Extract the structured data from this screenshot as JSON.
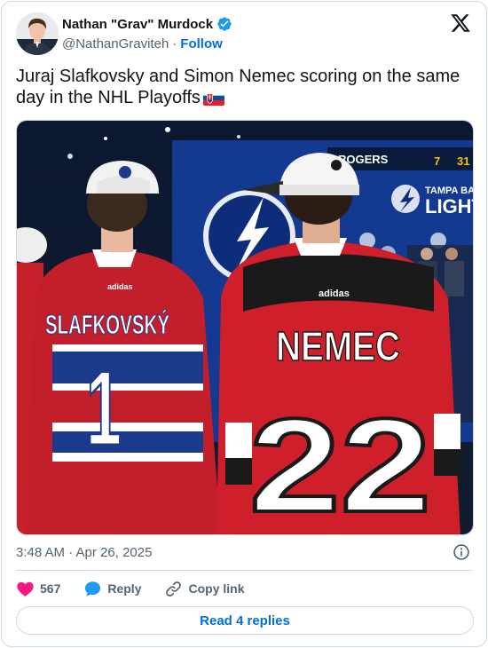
{
  "author": {
    "display_name": "Nathan \"Grav\" Murdock",
    "handle": "@NathanGraviteh",
    "separator": "·",
    "follow_label": "Follow"
  },
  "tweet": {
    "text": "Juraj Slafkovsky and Simon Nemec scoring on the same day in the NHL Playoffs",
    "flag_icon": "slovakia-flag-emoji",
    "timestamp": "3:48 AM · Apr 26, 2025"
  },
  "media": {
    "jersey_left_name": "SLAFKOVSKÝ",
    "jersey_left_number": "1",
    "jersey_right_name": "NEMEC",
    "jersey_right_number": "22",
    "sponsor_text": "ROGERS",
    "team_banner_text_1": "TAMPA BA",
    "team_banner_text_2": "LIGHT",
    "brand_logo_text": "adidas",
    "scoreboard_left": "7",
    "scoreboard_right": "31"
  },
  "actions": {
    "like_count": "567",
    "reply_label": "Reply",
    "copy_link_label": "Copy link"
  },
  "read_replies_label": "Read 4 replies",
  "colors": {
    "link_blue": "#006fd6",
    "heart_pink": "#f91880",
    "reply_blue": "#1d9bf0",
    "text_gray": "#536471",
    "border": "#cfd9de"
  }
}
